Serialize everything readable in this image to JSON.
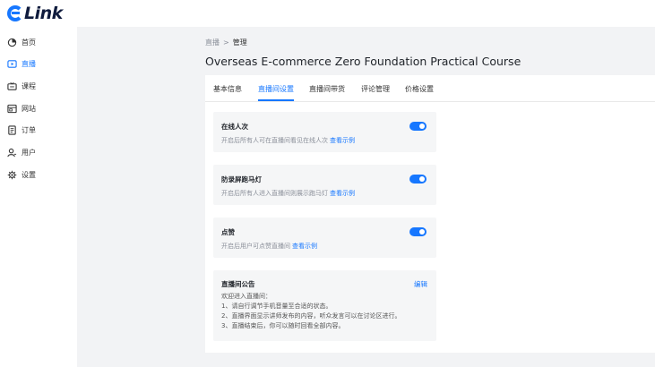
{
  "brand": {
    "logo_text": "Link"
  },
  "sidebar": {
    "items": [
      {
        "label": "首页",
        "icon": "dashboard-icon"
      },
      {
        "label": "直播",
        "icon": "live-icon",
        "active": true
      },
      {
        "label": "课程",
        "icon": "course-icon"
      },
      {
        "label": "网站",
        "icon": "website-icon"
      },
      {
        "label": "订单",
        "icon": "order-icon"
      },
      {
        "label": "用户",
        "icon": "user-icon"
      },
      {
        "label": "设置",
        "icon": "gear-icon"
      }
    ]
  },
  "breadcrumb": {
    "parent": "直播",
    "separator": ">",
    "current": "管理"
  },
  "page": {
    "title": "Overseas E-commerce Zero Foundation Practical Course"
  },
  "tabs": [
    {
      "label": "基本信息"
    },
    {
      "label": "直播间设置",
      "active": true
    },
    {
      "label": "直播间带货"
    },
    {
      "label": "评论管理"
    },
    {
      "label": "价格设置"
    }
  ],
  "settings": [
    {
      "title": "在线人次",
      "desc": "开启后所有人可在直播间看见在线人次",
      "link": "查看示例",
      "enabled": true
    },
    {
      "title": "防录屏跑马灯",
      "desc": "开启后所有人进入直播间则展示跑马灯",
      "link": "查看示例",
      "enabled": true
    },
    {
      "title": "点赞",
      "desc": "开启后用户可点赞直播间",
      "link": "查看示例",
      "enabled": true
    }
  ],
  "notice": {
    "title": "直播间公告",
    "edit_label": "编辑",
    "lines": [
      "欢迎进入直播间：",
      "1、请自行调节手机音量至合适的状态。",
      "2、直播界面显示讲师发布的内容，听众发言可以在讨论区进行。",
      "3、直播结束后，你可以随时回看全部内容。"
    ]
  },
  "colors": {
    "accent": "#1677ff",
    "background": "#f2f3f5"
  }
}
